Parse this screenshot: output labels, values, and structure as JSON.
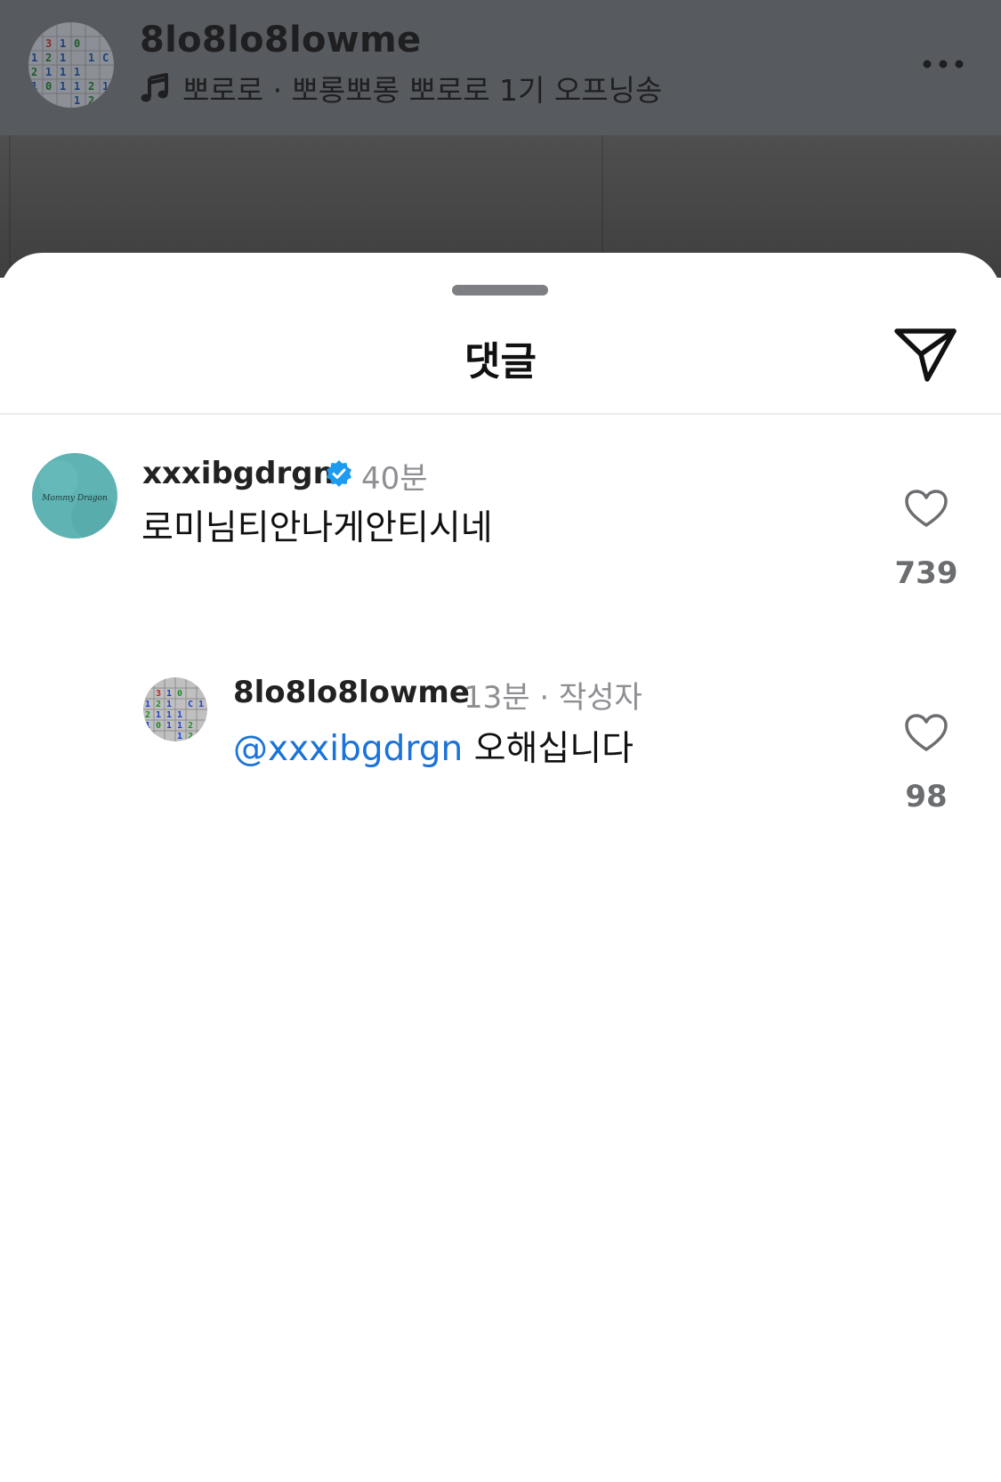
{
  "header": {
    "username": "8lo8lo8lowme",
    "music_text": "뽀로로 · 뽀롱뽀롱 뽀로로 1기 오프닝송",
    "music_icon": "music-note-icon",
    "more_icon": "more-horizontal-icon"
  },
  "sheet": {
    "title": "댓글",
    "send_icon": "send-icon"
  },
  "comments": [
    {
      "username": "xxxibgdrgn",
      "verified": true,
      "time": "40분",
      "text": "로미님티안나게안티시네",
      "likes": "739"
    }
  ],
  "replies": [
    {
      "username": "8lo8lo8lowme",
      "meta": "13분 · 작성자",
      "mention": "@xxxibgdrgn",
      "text": "오해십니다",
      "likes": "98"
    }
  ],
  "avatar_text": {
    "calligraphy": "Mommy Dragon"
  },
  "colors": {
    "mention": "#1a73d9",
    "verified": "#1d9bf0",
    "meta": "#8e8e93"
  }
}
